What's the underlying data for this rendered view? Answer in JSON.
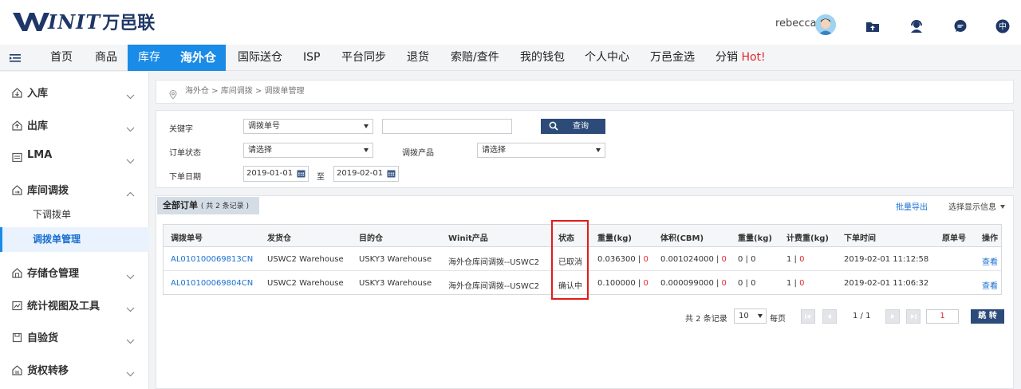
{
  "header": {
    "logo_text": "INIT",
    "logo_cn": "万邑联",
    "username": "rebecca",
    "icons": [
      "upload-folder-icon",
      "support-agent-icon",
      "chat-icon",
      "language-cn-icon"
    ],
    "language": "中"
  },
  "nav": {
    "items": [
      {
        "label": "首页",
        "active": false
      },
      {
        "label": "商品",
        "active": false
      },
      {
        "label": "库存",
        "active": true
      },
      {
        "label": "海外仓",
        "active": true
      },
      {
        "label": "国际送仓",
        "active": false
      },
      {
        "label": "ISP",
        "active": false
      },
      {
        "label": "平台同步",
        "active": false
      },
      {
        "label": "退货",
        "active": false
      },
      {
        "label": "索赔/查件",
        "active": false
      },
      {
        "label": "我的钱包",
        "active": false
      },
      {
        "label": "个人中心",
        "active": false
      },
      {
        "label": "万邑金选",
        "active": false
      },
      {
        "label": "分销",
        "active": false
      }
    ],
    "hot_label": "Hot!",
    "accent": "#1a8be6"
  },
  "sidebar": {
    "groups": [
      {
        "label": "入库",
        "icon": "warehouse-in-icon",
        "expanded": false
      },
      {
        "label": "出库",
        "icon": "warehouse-out-icon",
        "expanded": false
      },
      {
        "label": "LMA",
        "icon": "list-icon",
        "expanded": false
      },
      {
        "label": "库间调拨",
        "icon": "transfer-icon",
        "expanded": true
      },
      {
        "label": "存储仓管理",
        "icon": "storage-icon",
        "expanded": false
      },
      {
        "label": "统计视图及工具",
        "icon": "stats-icon",
        "expanded": false
      },
      {
        "label": "自验货",
        "icon": "inspect-icon",
        "expanded": false
      },
      {
        "label": "货权转移",
        "icon": "ownership-icon",
        "expanded": false
      }
    ],
    "sub_items": [
      {
        "label": "下调拨单",
        "active": false
      },
      {
        "label": "调拨单管理",
        "active": true
      }
    ]
  },
  "breadcrumb": "海外仓 > 库间调拨 > 调拨单管理",
  "filters": {
    "keyword_label": "关键字",
    "keyword_select": "调拨单号",
    "keyword_value": "",
    "query_button": "查询",
    "status_label": "订单状态",
    "status_select": "请选择",
    "product_label": "调拨产品",
    "product_select": "请选择",
    "date_label": "下单日期",
    "date_from": "2019-01-01",
    "date_to_label": "至",
    "date_to": "2019-02-01"
  },
  "list": {
    "tab_label": "全部订单",
    "tab_count": "( 共 2 条记录 )",
    "export_label": "批量导出",
    "column_select_label": "选择显示信息",
    "columns": [
      "调拨单号",
      "发货仓",
      "目的仓",
      "Winit产品",
      "状态",
      "重量(kg)",
      "体积(CBM)",
      "重量(kg)",
      "计费重(kg)",
      "下单时间",
      "原单号",
      "操作"
    ],
    "rows": [
      {
        "order_no": "AL010100069813CN",
        "from_wh": "USWC2 Warehouse",
        "to_wh": "USKY3 Warehouse",
        "product": "海外仓库间调拨--USWC2",
        "status": "已取消",
        "weight": "0.036300",
        "weight_alt": "0",
        "volume": "0.001024000",
        "volume_alt": "0",
        "weight2": "0",
        "weight2_alt": "0",
        "chargeable": "1",
        "chargeable_alt": "0",
        "created": "2019-02-01 11:12:58",
        "orig_no": "",
        "action": "查看"
      },
      {
        "order_no": "AL010100069804CN",
        "from_wh": "USWC2 Warehouse",
        "to_wh": "USKY3 Warehouse",
        "product": "海外仓库间调拨--USWC2",
        "status": "确认中",
        "weight": "0.100000",
        "weight_alt": "0",
        "volume": "0.000099000",
        "volume_alt": "0",
        "weight2": "0",
        "weight2_alt": "0",
        "chargeable": "1",
        "chargeable_alt": "0",
        "created": "2019-02-01 11:06:32",
        "orig_no": "",
        "action": "查看"
      }
    ]
  },
  "pagination": {
    "total_text": "共 2 条记录",
    "page_size": "10",
    "per_page_label": "每页",
    "page_info": "1 / 1",
    "jump_value": "1",
    "jump_button": "跳 转"
  }
}
